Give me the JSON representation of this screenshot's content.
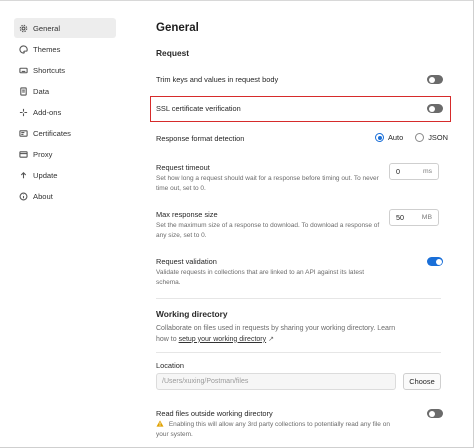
{
  "sidebar": {
    "items": [
      {
        "label": "General",
        "icon": "gear-icon",
        "active": true
      },
      {
        "label": "Themes",
        "icon": "palette-icon"
      },
      {
        "label": "Shortcuts",
        "icon": "keyboard-icon"
      },
      {
        "label": "Data",
        "icon": "database-icon"
      },
      {
        "label": "Add-ons",
        "icon": "sparkle-icon"
      },
      {
        "label": "Certificates",
        "icon": "certificate-icon"
      },
      {
        "label": "Proxy",
        "icon": "proxy-icon"
      },
      {
        "label": "Update",
        "icon": "update-icon"
      },
      {
        "label": "About",
        "icon": "info-icon"
      }
    ]
  },
  "main": {
    "title": "General",
    "request_section": "Request",
    "trim_keys": {
      "label": "Trim keys and values in request body",
      "enabled": false
    },
    "ssl_verification": {
      "label": "SSL certificate verification",
      "enabled": false
    },
    "response_format": {
      "label": "Response format detection",
      "options": [
        {
          "label": "Auto",
          "checked": true
        },
        {
          "label": "JSON",
          "checked": false
        }
      ]
    },
    "request_timeout": {
      "label": "Request timeout",
      "desc": "Set how long a request should wait for a response before timing out. To never time out, set to 0.",
      "value": "0",
      "unit": "ms"
    },
    "max_response_size": {
      "label": "Max response size",
      "desc": "Set the maximum size of a response to download. To download a response of any size, set to 0.",
      "value": "50",
      "unit": "MB"
    },
    "request_validation": {
      "label": "Request validation",
      "desc": "Validate requests in collections that are linked to an API against its latest schema.",
      "enabled": true
    },
    "working_dir": {
      "title": "Working directory",
      "desc": "Collaborate on files used in requests by sharing your working directory. Learn how to",
      "link": "setup your working directory",
      "link_arrow": "↗",
      "location_label": "Location",
      "path": "/Users/xuxing/Postman/files",
      "choose_label": "Choose"
    },
    "read_outside": {
      "label": "Read files outside working directory",
      "warning": "Enabling this will allow any 3rd party collections to potentially read any file on your system.",
      "enabled": false
    },
    "colors": {
      "accent": "#1a6fd8",
      "highlight": "#d62b2b",
      "toggle_off": "#6b6b6b"
    }
  }
}
